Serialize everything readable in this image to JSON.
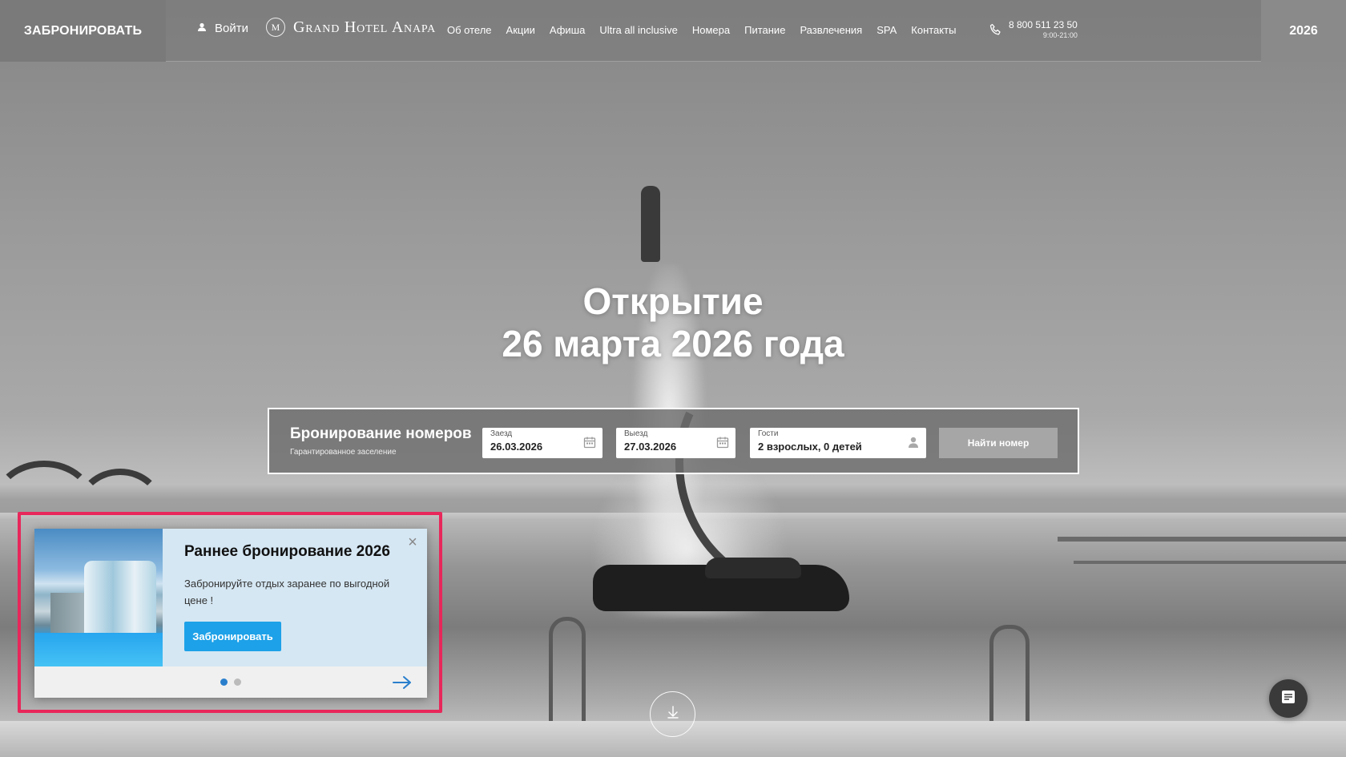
{
  "header": {
    "book_button": "ЗАБРОНИРОВАТЬ",
    "login_label": "Войти",
    "logo_text": "Grand Hotel Anapa",
    "logo_mark": "M",
    "nav": [
      "Об отеле",
      "Акции",
      "Афиша",
      "Ultra all inclusive",
      "Номера",
      "Питание",
      "Развлечения",
      "SPA",
      "Контакты"
    ],
    "phone": "8 800 511 23 50",
    "phone_hours": "9:00-21:00",
    "year": "2026"
  },
  "hero": {
    "headline_line1": "Открытие",
    "headline_line2": "26 марта 2026 года"
  },
  "booking": {
    "title": "Бронирование номеров",
    "subtitle": "Гарантированное заселение",
    "checkin_label": "Заезд",
    "checkin_value": "26.03.2026",
    "checkout_label": "Выезд",
    "checkout_value": "27.03.2026",
    "guests_label": "Гости",
    "guests_value": "2 взрослых, 0 детей",
    "find_button": "Найти номер"
  },
  "promo": {
    "title": "Раннее бронирование 2026",
    "text": "Забронируйте отдых заранее по выгодной цене !",
    "button": "Забронировать",
    "close": "×",
    "slides_total": 2,
    "active_slide": 1
  },
  "icons": {
    "user": "user-icon",
    "phone": "phone-icon",
    "calendar": "calendar-icon",
    "guest": "guest-icon",
    "close": "close-icon",
    "arrow_right": "arrow-right-icon",
    "scroll_down": "arrow-down-icon",
    "chat": "chat-icon"
  },
  "colors": {
    "promo_accent": "#1da1e8",
    "highlight_frame": "#e8275a",
    "dot_active": "#2a7fcc"
  }
}
